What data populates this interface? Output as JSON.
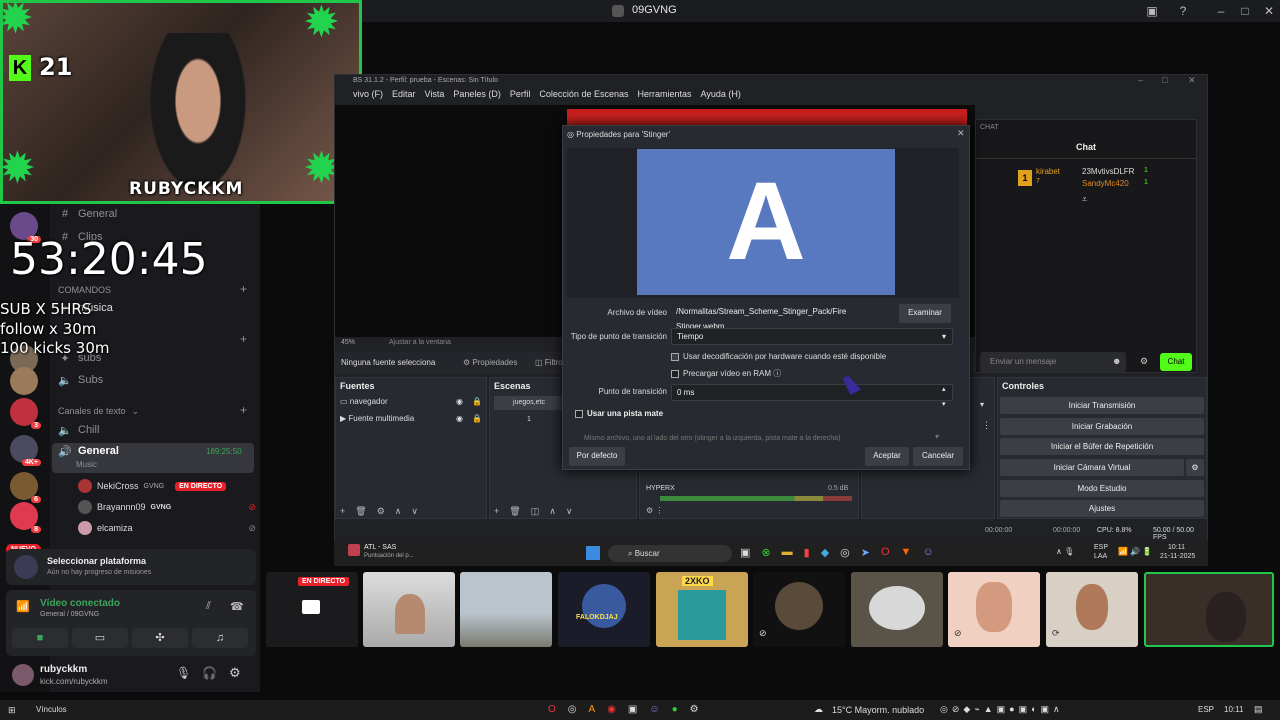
{
  "discord": {
    "window_title": "09GVNG",
    "channels": {
      "general_top": "General",
      "clips": "Clips",
      "category_commands": "COMANDOS",
      "musica": "música",
      "subs": "subs",
      "buses": "Subs",
      "category_text": "Canales de texto",
      "chill": "Chill",
      "general_voice": "General",
      "general_voice_time": "189:25:50",
      "music_status": "Music"
    },
    "voice_users": [
      {
        "name": "NekiCross",
        "tag": "GVNG",
        "live": "EN DIRECTO"
      },
      {
        "name": "Brayannn09",
        "tag": "GVNG"
      },
      {
        "name": "elcamiza",
        "tag": ""
      }
    ],
    "select_platform": {
      "title": "Seleccionar plataforma",
      "subtitle": "Aún no hay progreso de misiones"
    },
    "voice_connected": {
      "title": "Vídeo conectado",
      "subtitle": "General / 09GVNG"
    },
    "user": {
      "name": "rubyckkm",
      "status": "kick.com/rubyckkm"
    },
    "server_badges": [
      "30",
      "3",
      "4K+",
      "6",
      "8",
      "NUEVO"
    ]
  },
  "overlay": {
    "k_count": "21",
    "cam_name": "RUBYCKKM",
    "timer": "53:20:45",
    "lines": [
      "SUB X 5HRS",
      "follow x 30m",
      "100 kicks 30m"
    ]
  },
  "obs": {
    "title": "BS 31.1.2 - Perfil: prueba - Escenas: Sin Título",
    "menu": [
      "vivo (F)",
      "Editar",
      "Vista",
      "Paneles (D)",
      "Perfil",
      "Colección de Escenas",
      "Herramientas",
      "Ayuda (H)"
    ],
    "zoom": "45%",
    "fit": "Ajustar a la ventana",
    "no_source": "Ninguna fuente selecciona",
    "properties_btn": "Propiedades",
    "filters_btn": "Filtro",
    "sources_head": "Fuentes",
    "sources": [
      "navegador",
      "Fuente multimedia"
    ],
    "scenes_head": "Escenas",
    "scenes": [
      "juegos,etc",
      "1"
    ],
    "controls_head": "Controles",
    "controls": [
      "Iniciar Transmisión",
      "Iniciar Grabación",
      "Iniciar el Búfer de Repetición",
      "Iniciar Cámara Virtual",
      "Modo Estudio",
      "Ajustes"
    ],
    "mixer_label": "HYPERX",
    "mixer_db": "0.5 dB",
    "status": {
      "time1": "00:00:00",
      "time2": "00:00:00",
      "cpu": "CPU: 8.8%",
      "fps": "50.00 / 50.00 FPS"
    },
    "chat_dock": {
      "label": "CHAT",
      "title": "Chat",
      "users": [
        {
          "name": "kirabet",
          "rank": "1",
          "extra": "7"
        },
        {
          "name": "23MvtivsDLFR",
          "extra": "1"
        },
        {
          "name": "SandyMc420",
          "extra": "1"
        }
      ],
      "placeholder": "Enviar un mensaje",
      "send": "Chat"
    }
  },
  "dialog": {
    "title": "Propiedades para 'Stinger'",
    "preview_letter": "A",
    "file_label": "Archivo de vídeo",
    "file_value": "/Normalitas/Stream_Scheme_Stinger_Pack/Fire Stinger.webm",
    "browse": "Examinar",
    "transition_type_label": "Tipo de punto de transición",
    "transition_type_value": "Tiempo",
    "hw_decode": "Usar decodificación por hardware cuando esté disponible",
    "preload": "Precargar vídeo en RAM",
    "transition_point_label": "Punto de transición",
    "transition_point_value": "0 ms",
    "use_matte": "Usar una pista mate",
    "matte_hint": "Mismo archivo, uno al lado del otro (stinger a la izquierda, pista mate a la derecha)",
    "defaults": "Por defecto",
    "accept": "Aceptar",
    "cancel": "Cancelar"
  },
  "obs_taskbar": {
    "weather_tag": "ATL - SAS",
    "weather_sub": "Puntuación del p...",
    "search": "Buscar",
    "lang": "ESP",
    "lang2": "LAA",
    "time": "10:11",
    "date": "21-11-2025"
  },
  "thumbs": {
    "live": "EN DIRECTO",
    "game_label": "2XKO",
    "avatar_label": "FALOKDJAJ"
  },
  "taskbar": {
    "left": "Vínculos",
    "weather": "15°C  Mayorm. nublado",
    "lang": "ESP",
    "time": "10:11"
  },
  "colors": {
    "accent_green": "#22d34e",
    "live_red": "#e8202a",
    "kick_green": "#53fc18",
    "preview_blue": "#5878c0"
  }
}
